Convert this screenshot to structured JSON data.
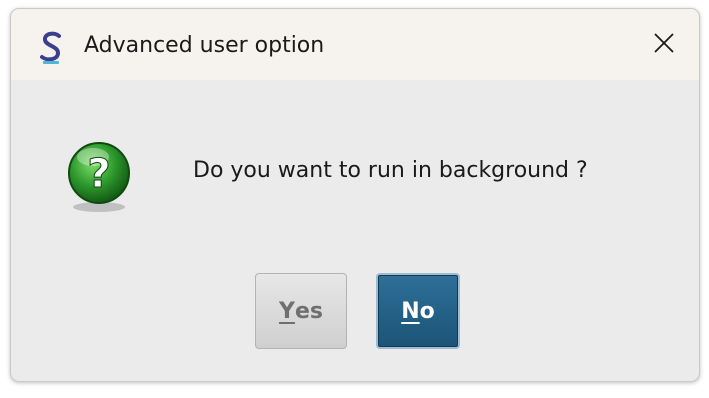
{
  "window": {
    "title": "Advanced user option",
    "app_icon": "s-logo-icon",
    "close_icon": "close-icon"
  },
  "dialog": {
    "icon": "question-icon",
    "message": "Do you want to run in background ?"
  },
  "buttons": {
    "yes": {
      "mnemonic": "Y",
      "rest": "es"
    },
    "no": {
      "mnemonic": "N",
      "rest": "o"
    }
  },
  "colors": {
    "accent_button": "#1b5477",
    "question_icon_green": "#2e9a2e"
  }
}
